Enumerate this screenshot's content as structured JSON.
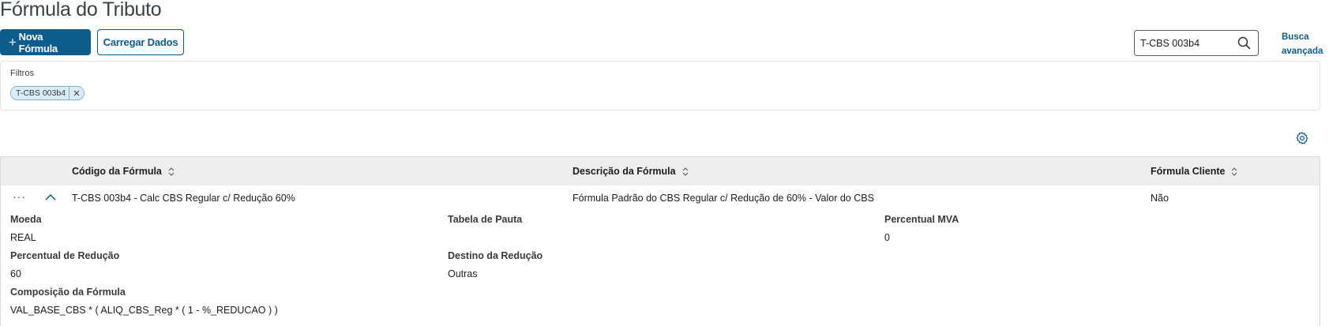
{
  "page": {
    "title": "Fórmula do Tributo"
  },
  "toolbar": {
    "new_formula_plus": "+",
    "new_formula_label": "Nova Fórmula",
    "load_data_label": "Carregar Dados"
  },
  "search": {
    "value": "T-CBS 003b4",
    "advanced_line1": "Busca",
    "advanced_line2": "avançada"
  },
  "filters": {
    "label": "Filtros",
    "chips": [
      {
        "label": "T-CBS 003b4"
      }
    ]
  },
  "colors": {
    "primary": "#0c5c8c",
    "header_bg": "#eeeeee",
    "chip_bg": "#d8ecfb",
    "chip_border": "#7fb4dc"
  },
  "table": {
    "columns": [
      "Código da Fórmula",
      "Descrição da Fórmula",
      "Fórmula Cliente"
    ],
    "rows": [
      {
        "menu": "···",
        "codigo": "T-CBS 003b4 - Calc CBS Regular c/ Redução 60%",
        "descricao": "Fórmula Padrão do CBS Regular c/ Redução de 60% - Valor do CBS",
        "cliente": "Não",
        "details": {
          "moeda_label": "Moeda",
          "moeda_value": "REAL",
          "tabela_pauta_label": "Tabela de Pauta",
          "tabela_pauta_value": "",
          "percentual_mva_label": "Percentual MVA",
          "percentual_mva_value": "0",
          "percentual_reducao_label": "Percentual de Redução",
          "percentual_reducao_value": "60",
          "destino_reducao_label": "Destino da Redução",
          "destino_reducao_value": "Outras",
          "composicao_label": "Composição da Fórmula",
          "composicao_value": "VAL_BASE_CBS * ( ALIQ_CBS_Reg * ( 1 - %_REDUCAO ) )"
        }
      }
    ]
  },
  "icons": {
    "search": "search-icon",
    "close": "close-icon",
    "settings": "gear-icon",
    "sort": "sort-icon",
    "collapse": "chevron-up-icon",
    "menu": "more-horizontal-icon"
  }
}
